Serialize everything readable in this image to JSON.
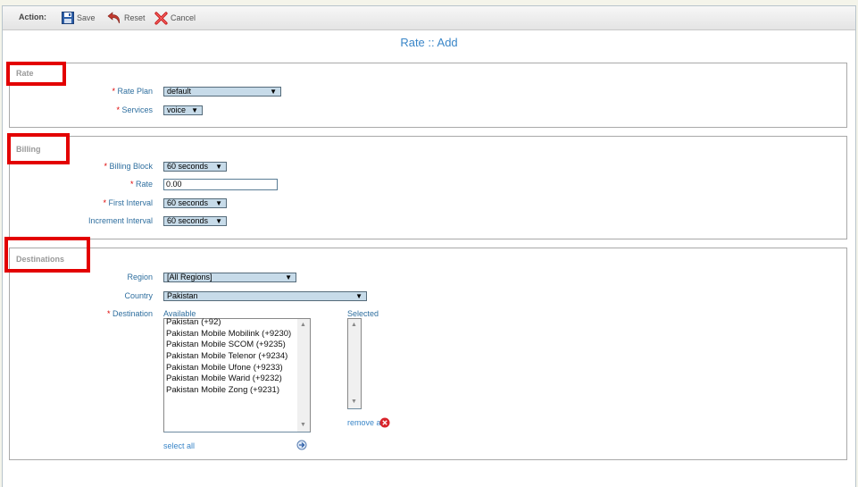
{
  "toolbar": {
    "action_label": "Action:",
    "save_label": "Save",
    "reset_label": "Reset",
    "cancel_label": "Cancel"
  },
  "page_title": "Rate :: Add",
  "sections": {
    "rate": {
      "legend": "Rate",
      "rate_plan": {
        "label": "Rate Plan",
        "value": "default"
      },
      "services": {
        "label": "Services",
        "value": "voice"
      }
    },
    "billing": {
      "legend": "Billing",
      "billing_block": {
        "label": "Billing Block",
        "value": "60 seconds"
      },
      "rate": {
        "label": "Rate",
        "value": "0.00"
      },
      "first_interval": {
        "label": "First Interval",
        "value": "60 seconds"
      },
      "increment_interval": {
        "label": "Increment Interval",
        "value": "60 seconds"
      }
    },
    "destinations": {
      "legend": "Destinations",
      "region": {
        "label": "Region",
        "value": "[All Regions]"
      },
      "country": {
        "label": "Country",
        "value": "Pakistan"
      },
      "destination": {
        "label": "Destination",
        "available_label": "Available",
        "selected_label": "Selected",
        "available": [
          "Pakistan (+92)",
          "Pakistan Mobile Mobilink (+9230)",
          "Pakistan Mobile SCOM (+9235)",
          "Pakistan Mobile Telenor (+9234)",
          "Pakistan Mobile Ufone (+9233)",
          "Pakistan Mobile Warid (+9232)",
          "Pakistan Mobile Zong (+9231)"
        ],
        "select_all": "select all",
        "remove_all": "remove a"
      }
    }
  },
  "required_mark": "*",
  "colors": {
    "highlight": "#e30000",
    "link": "#3a86c8",
    "select_bg": "#c7dbe9"
  },
  "icons": [
    "save-icon",
    "reset-icon",
    "cancel-icon",
    "add-arrow-icon",
    "remove-icon"
  ]
}
